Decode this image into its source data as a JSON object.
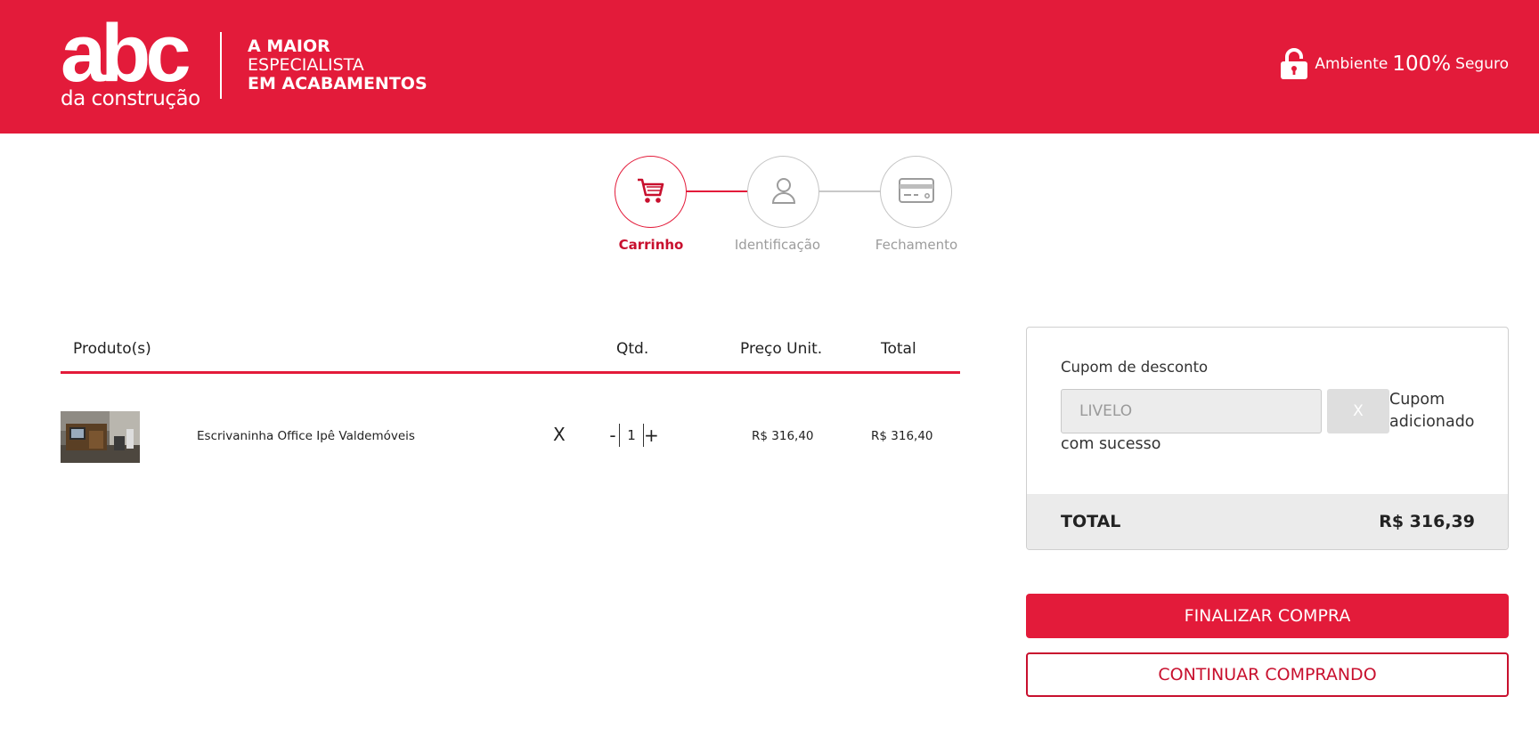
{
  "header": {
    "logo_main": "abc",
    "logo_sub": "da construção",
    "tagline_line1": "A MAIOR",
    "tagline_line2": "ESPECIALISTA",
    "tagline_line3": "EM ACABAMENTOS",
    "secure_prefix": "Ambiente",
    "secure_percent": "100%",
    "secure_suffix": "Seguro",
    "brand_color": "#e31b3a"
  },
  "steps": [
    {
      "label": "Carrinho",
      "icon": "cart-icon",
      "active": true
    },
    {
      "label": "Identificação",
      "icon": "user-icon",
      "active": false
    },
    {
      "label": "Fechamento",
      "icon": "credit-card-icon",
      "active": false
    }
  ],
  "cart": {
    "columns": {
      "product": "Produto(s)",
      "qty": "Qtd.",
      "unit_price": "Preço Unit.",
      "total": "Total"
    },
    "items": [
      {
        "name": "Escrivaninha Office Ipê Valdemóveis",
        "remove": "X",
        "qty": "1",
        "minus": "-",
        "plus": "+",
        "unit_price": "R$ 316,40",
        "total": "R$ 316,40"
      }
    ]
  },
  "summary": {
    "coupon_label": "Cupom de desconto",
    "coupon_value": "LIVELO",
    "coupon_button": "X",
    "coupon_msg_part1": "Cupom adicionado",
    "coupon_msg_part2": "com sucesso",
    "total_label": "TOTAL",
    "total_value": "R$ 316,39"
  },
  "actions": {
    "checkout": "FINALIZAR COMPRA",
    "continue": "CONTINUAR COMPRANDO"
  }
}
